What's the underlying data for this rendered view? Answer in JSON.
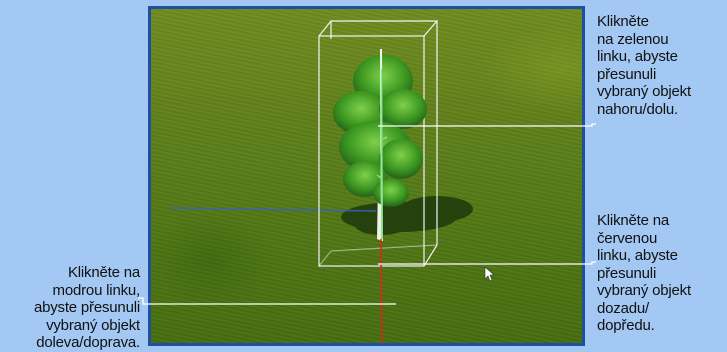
{
  "callouts": {
    "blue_line": [
      "Klikněte na",
      "modrou linku,",
      "abyste přesunuli",
      "vybraný objekt",
      "doleva/doprava."
    ],
    "green_line": [
      "Klikněte",
      "na zelenou",
      "linku, abyste",
      "přesunuli",
      "vybraný objekt",
      "nahoru/dolu."
    ],
    "red_line": [
      "Klikněte na",
      "červenou",
      "linku, abyste",
      "přesunuli",
      "vybraný objekt",
      "dozadu/",
      "dopředu."
    ]
  },
  "colors": {
    "background": "#a3c8f3",
    "frame": "#1f4fa0",
    "grass": "#5f801a",
    "gizmo_blue": "#3a5fd0",
    "gizmo_green": "#39d64a",
    "gizmo_red": "#d8281b"
  },
  "scene": {
    "object": "birch-tree",
    "gizmo_axes": [
      "blue",
      "green",
      "red"
    ]
  }
}
